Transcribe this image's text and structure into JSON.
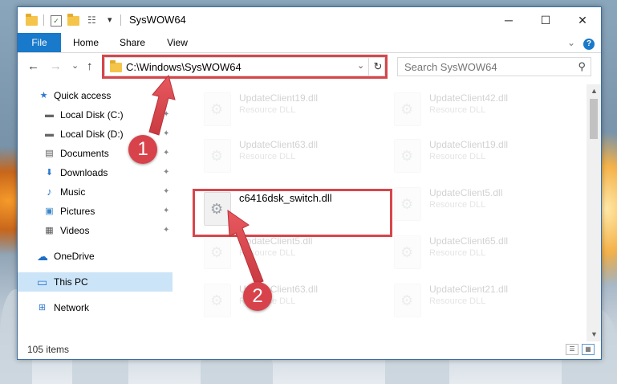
{
  "window": {
    "title": "SysWOW64",
    "minimize_glyph": "─",
    "maximize_glyph": "☐",
    "close_glyph": "✕"
  },
  "quick_access_toolbar": {
    "dropdown_glyph": "▾"
  },
  "ribbon": {
    "tabs": [
      "File",
      "Home",
      "Share",
      "View"
    ],
    "collapse_glyph": "⌄",
    "help_glyph": "?"
  },
  "address_bar": {
    "back_glyph": "←",
    "forward_glyph": "→",
    "recent_glyph": "⌄",
    "up_glyph": "↑",
    "path": "C:\\Windows\\SysWOW64",
    "dropdown_glyph": "⌄",
    "refresh_glyph": "↻"
  },
  "search": {
    "placeholder": "Search SysWOW64",
    "icon_glyph": "⚲"
  },
  "nav_pane": {
    "items": [
      {
        "label": "Quick access",
        "icon": "star-icon",
        "glyph": "★",
        "pinned": false
      },
      {
        "label": "Local Disk (C:)",
        "icon": "drive-icon",
        "glyph": "▬",
        "pinned": true
      },
      {
        "label": "Local Disk (D:)",
        "icon": "drive-icon",
        "glyph": "▬",
        "pinned": true
      },
      {
        "label": "Documents",
        "icon": "documents-icon",
        "glyph": "▤",
        "pinned": true
      },
      {
        "label": "Downloads",
        "icon": "download-icon",
        "glyph": "⬇",
        "pinned": true
      },
      {
        "label": "Music",
        "icon": "music-icon",
        "glyph": "♪",
        "pinned": true
      },
      {
        "label": "Pictures",
        "icon": "pictures-icon",
        "glyph": "▣",
        "pinned": true
      },
      {
        "label": "Videos",
        "icon": "videos-icon",
        "glyph": "▦",
        "pinned": true
      },
      {
        "label": "OneDrive",
        "icon": "cloud-icon",
        "glyph": "☁",
        "pinned": false
      },
      {
        "label": "This PC",
        "icon": "computer-icon",
        "glyph": "▭",
        "pinned": false,
        "selected": true
      },
      {
        "label": "Network",
        "icon": "network-icon",
        "glyph": "⊞",
        "pinned": false
      }
    ],
    "pin_glyph": "📌"
  },
  "files": {
    "highlighted": {
      "name": "c6416dsk_switch.dll"
    },
    "faded_names": [
      "UpdateClient19.dll",
      "UpdateClient42.dll",
      "UpdateClient63.dll",
      "UpdateClient19.dll",
      "UpdateClient5.dll",
      "UpdateClient5.dll",
      "UpdateClient65.dll",
      "UpdateClient63.dll",
      "UpdateClient21.dll"
    ],
    "faded_type": "Resource DLL"
  },
  "scrollbar": {
    "up_glyph": "▲",
    "down_glyph": "▼"
  },
  "status_bar": {
    "item_count": "105 items",
    "details_view_glyph": "☰",
    "tiles_view_glyph": "▦"
  },
  "callouts": [
    "1",
    "2"
  ],
  "colors": {
    "accent": "#1979ca",
    "highlight": "#d6464b",
    "selected_nav": "#cce4f7"
  }
}
